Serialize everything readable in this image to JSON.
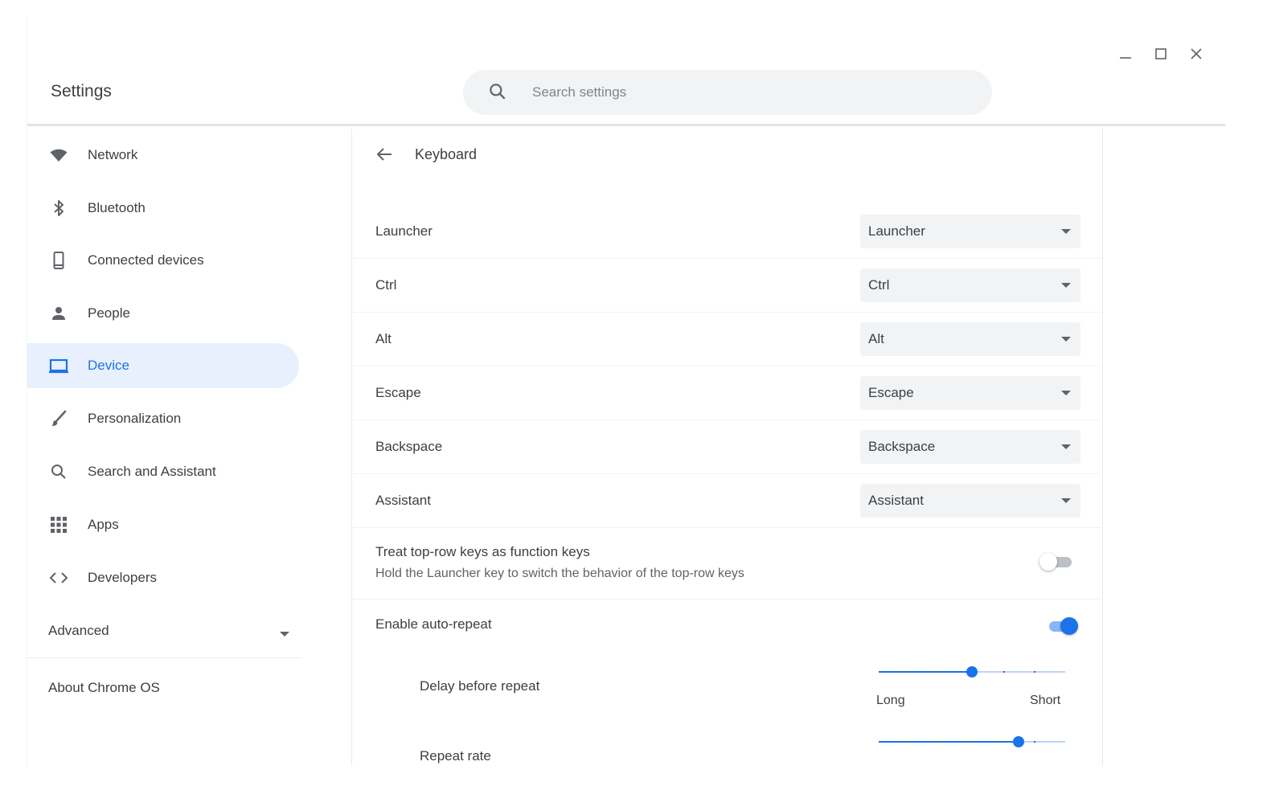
{
  "window": {
    "controls": [
      {
        "name": "minimize-button",
        "icon": "minimize-icon"
      },
      {
        "name": "maximize-button",
        "icon": "maximize-icon"
      },
      {
        "name": "close-button",
        "icon": "close-icon"
      }
    ]
  },
  "header": {
    "title": "Settings",
    "search_placeholder": "Search settings"
  },
  "sidebar": {
    "items": [
      {
        "label": "Network",
        "icon": "wifi-icon",
        "active": false
      },
      {
        "label": "Bluetooth",
        "icon": "bluetooth-icon",
        "active": false
      },
      {
        "label": "Connected devices",
        "icon": "phone-icon",
        "active": false
      },
      {
        "label": "People",
        "icon": "person-icon",
        "active": false
      },
      {
        "label": "Device",
        "icon": "laptop-icon",
        "active": true
      },
      {
        "label": "Personalization",
        "icon": "brush-icon",
        "active": false
      },
      {
        "label": "Search and Assistant",
        "icon": "search-icon",
        "active": false
      },
      {
        "label": "Apps",
        "icon": "apps-grid-icon",
        "active": false
      },
      {
        "label": "Developers",
        "icon": "code-icon",
        "active": false
      }
    ],
    "advanced": "Advanced",
    "about": "About Chrome OS"
  },
  "main": {
    "title": "Keyboard",
    "key_rows": [
      {
        "label": "Launcher",
        "value": "Launcher"
      },
      {
        "label": "Ctrl",
        "value": "Ctrl"
      },
      {
        "label": "Alt",
        "value": "Alt"
      },
      {
        "label": "Escape",
        "value": "Escape"
      },
      {
        "label": "Backspace",
        "value": "Backspace"
      },
      {
        "label": "Assistant",
        "value": "Assistant"
      }
    ],
    "function_keys": {
      "label": "Treat top-row keys as function keys",
      "sublabel": "Hold the Launcher key to switch the behavior of the top-row keys",
      "enabled": false
    },
    "auto_repeat": {
      "label": "Enable auto-repeat",
      "enabled": true
    },
    "delay": {
      "label": "Delay before repeat",
      "min_label": "Long",
      "max_label": "Short",
      "value": 0.5
    },
    "repeat_rate": {
      "label": "Repeat rate",
      "value": 0.75
    }
  },
  "colors": {
    "accent": "#1a73e8",
    "active_bg": "#e8f0fe",
    "text": "#3c4043",
    "secondary_text": "#5f6368"
  }
}
